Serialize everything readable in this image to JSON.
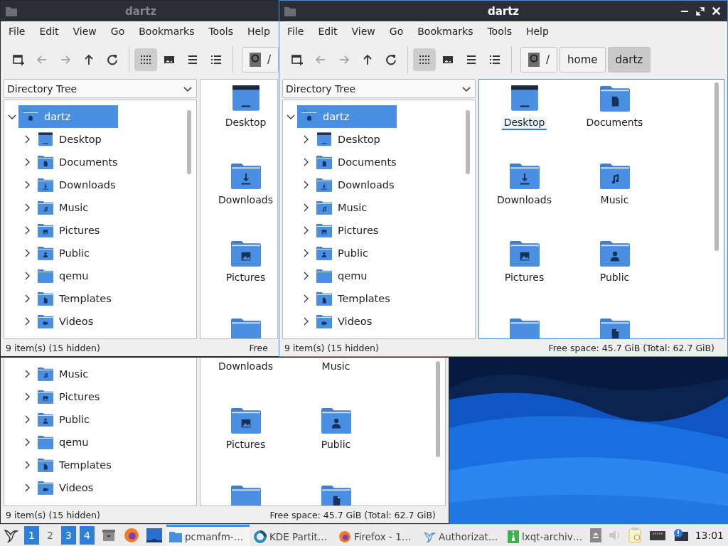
{
  "windows": [
    {
      "title": "dartz",
      "active": false,
      "menu": [
        "File",
        "Edit",
        "View",
        "Go",
        "Bookmarks",
        "Tools",
        "Help"
      ],
      "nav": [
        {
          "kind": "new-tab",
          "disabled": false
        },
        {
          "kind": "back",
          "disabled": true
        },
        {
          "kind": "forward",
          "disabled": true
        },
        {
          "kind": "up",
          "disabled": false
        },
        {
          "kind": "reload",
          "disabled": false
        }
      ],
      "views": [
        {
          "kind": "icons",
          "selected": true
        },
        {
          "kind": "thumbnails",
          "selected": false
        },
        {
          "kind": "compact",
          "selected": false
        },
        {
          "kind": "list",
          "selected": false
        }
      ],
      "path": [
        {
          "label": "/",
          "kind": "root",
          "selected": false
        }
      ],
      "side_pane": "Directory Tree",
      "tree": [
        {
          "label": "dartz",
          "kind": "home",
          "selected": true,
          "expanded": true,
          "children": [
            {
              "label": "Desktop",
              "kind": "desktop",
              "selected": false,
              "expanded": false
            },
            {
              "label": "Documents",
              "kind": "documents",
              "selected": false,
              "expanded": false
            },
            {
              "label": "Downloads",
              "kind": "downloads",
              "selected": false,
              "expanded": false
            },
            {
              "label": "Music",
              "kind": "music",
              "selected": false,
              "expanded": false
            },
            {
              "label": "Pictures",
              "kind": "pictures",
              "selected": false,
              "expanded": false
            },
            {
              "label": "Public",
              "kind": "public",
              "selected": false,
              "expanded": false
            },
            {
              "label": "qemu",
              "kind": "folder",
              "selected": false,
              "expanded": false
            },
            {
              "label": "Templates",
              "kind": "templates",
              "selected": false,
              "expanded": false
            },
            {
              "label": "Videos",
              "kind": "videos",
              "selected": false,
              "expanded": false
            }
          ]
        }
      ],
      "icons": [
        {
          "label": "Desktop",
          "kind": "desktop",
          "focused": false
        },
        {
          "label": "Downloads",
          "kind": "downloads",
          "focused": false
        },
        {
          "label": "Pictures",
          "kind": "pictures",
          "focused": false
        },
        {
          "kind": "folder"
        }
      ],
      "scrollbars": {
        "tree": true,
        "icons": false
      },
      "status": {
        "items": "9 item(s) (15 hidden)",
        "free": "Free"
      }
    },
    {
      "title": "dartz",
      "active": true,
      "window_buttons": [
        {
          "kind": "minimize"
        },
        {
          "kind": "maximize"
        },
        {
          "kind": "close"
        }
      ],
      "menu": [
        "File",
        "Edit",
        "View",
        "Go",
        "Bookmarks",
        "Tools",
        "Help"
      ],
      "nav": [
        {
          "kind": "new-tab",
          "disabled": false
        },
        {
          "kind": "back",
          "disabled": true
        },
        {
          "kind": "forward",
          "disabled": true
        },
        {
          "kind": "up",
          "disabled": false
        },
        {
          "kind": "reload",
          "disabled": false
        }
      ],
      "views": [
        {
          "kind": "icons",
          "selected": true
        },
        {
          "kind": "thumbnails",
          "selected": false
        },
        {
          "kind": "compact",
          "selected": false
        },
        {
          "kind": "list",
          "selected": false
        }
      ],
      "path": [
        {
          "label": "/",
          "kind": "root",
          "selected": false
        },
        {
          "label": "home",
          "selected": false
        },
        {
          "label": "dartz",
          "selected": true
        }
      ],
      "side_pane": "Directory Tree",
      "tree": [
        {
          "label": "dartz",
          "kind": "home",
          "selected": true,
          "expanded": true,
          "children": [
            {
              "label": "Desktop",
              "kind": "desktop",
              "selected": false,
              "expanded": false
            },
            {
              "label": "Documents",
              "kind": "documents",
              "selected": false,
              "expanded": false
            },
            {
              "label": "Downloads",
              "kind": "downloads",
              "selected": false,
              "expanded": false
            },
            {
              "label": "Music",
              "kind": "music",
              "selected": false,
              "expanded": false
            },
            {
              "label": "Pictures",
              "kind": "pictures",
              "selected": false,
              "expanded": false
            },
            {
              "label": "Public",
              "kind": "public",
              "selected": false,
              "expanded": false
            },
            {
              "label": "qemu",
              "kind": "folder",
              "selected": false,
              "expanded": false
            },
            {
              "label": "Templates",
              "kind": "templates",
              "selected": false,
              "expanded": false
            },
            {
              "label": "Videos",
              "kind": "videos",
              "selected": false,
              "expanded": false
            }
          ]
        }
      ],
      "icons": [
        {
          "label": "Desktop",
          "kind": "desktop",
          "focused": true
        },
        {
          "label": "Documents",
          "kind": "documents",
          "focused": false
        },
        {
          "label": "Downloads",
          "kind": "downloads",
          "focused": false
        },
        {
          "label": "Music",
          "kind": "music",
          "focused": false
        },
        {
          "label": "Pictures",
          "kind": "pictures",
          "focused": false
        },
        {
          "label": "Public",
          "kind": "public",
          "focused": false
        },
        {
          "kind": "folder"
        },
        {
          "kind": "templates"
        }
      ],
      "scrollbars": {
        "tree": true,
        "icons": true
      },
      "status": {
        "items": "9 item(s) (15 hidden)",
        "free": "Free space: 45.7 GiB (Total: 62.7 GiB)"
      }
    },
    {
      "active": false,
      "tree": [
        {
          "children": [
            {
              "label": "Music",
              "kind": "music",
              "selected": false,
              "expanded": false
            },
            {
              "label": "Pictures",
              "kind": "pictures",
              "selected": false,
              "expanded": false
            },
            {
              "label": "Public",
              "kind": "public",
              "selected": false,
              "expanded": false
            },
            {
              "label": "qemu",
              "kind": "folder",
              "selected": false,
              "expanded": false
            },
            {
              "label": "Templates",
              "kind": "templates",
              "selected": false,
              "expanded": false
            },
            {
              "label": "Videos",
              "kind": "videos",
              "selected": false,
              "expanded": false
            }
          ]
        }
      ],
      "icons": [
        {
          "label": "Downloads",
          "focused": false
        },
        {
          "label": "Music",
          "focused": false
        },
        {
          "label": "Pictures",
          "kind": "pictures",
          "focused": false
        },
        {
          "label": "Public",
          "kind": "public",
          "focused": false
        },
        {
          "kind": "folder"
        },
        {
          "kind": "templates"
        }
      ],
      "scrollbars": {
        "tree": false,
        "icons": true
      },
      "status": {
        "items": "9 item(s) (15 hidden)",
        "free": "Free space: 45.7 GiB (Total: 62.7 GiB)"
      }
    }
  ],
  "taskbar": {
    "workspaces": [
      {
        "label": "1",
        "selected": true
      },
      {
        "label": "2",
        "selected": false
      },
      {
        "label": "3",
        "selected": true
      },
      {
        "label": "4",
        "selected": true
      }
    ],
    "launchers": [
      {
        "kind": "files"
      },
      {
        "kind": "browser"
      },
      {
        "kind": "desktop"
      }
    ],
    "tasks": [
      {
        "label": "pcmanfm-…",
        "kind": "folder",
        "selected": true
      },
      {
        "label": "KDE Partit…",
        "kind": "partition",
        "selected": false
      },
      {
        "label": "Firefox - 1…",
        "kind": "browser",
        "selected": false
      },
      {
        "label": "Authorizat…",
        "kind": "bird",
        "selected": false
      },
      {
        "label": "lxqt-archiv…",
        "kind": "archive",
        "selected": false
      }
    ],
    "tray": [
      {
        "kind": "eject",
        "disabled": false
      },
      {
        "kind": "volume",
        "disabled": true
      },
      {
        "kind": "clipboard",
        "disabled": false
      },
      {
        "kind": "network",
        "disabled": false
      },
      {
        "kind": "notification",
        "disabled": false
      }
    ],
    "clock": "13:01"
  }
}
